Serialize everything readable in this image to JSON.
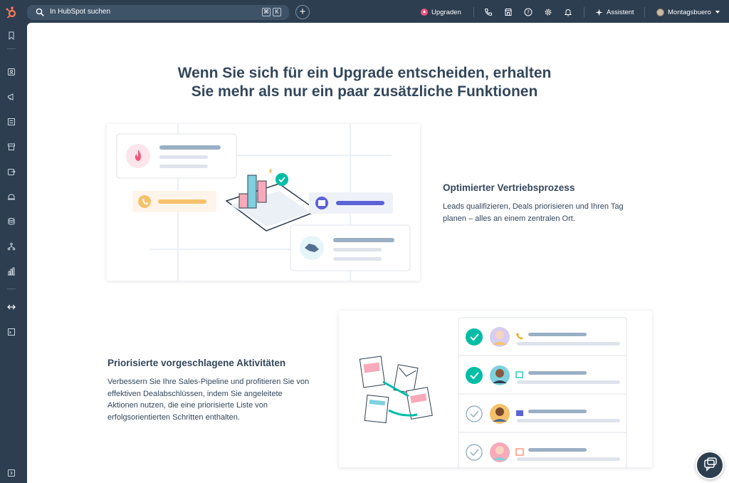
{
  "topbar": {
    "search_placeholder": "In HubSpot suchen",
    "shortcut_keys": [
      "⌘",
      "K"
    ],
    "upgrade_label": "Upgraden",
    "assistant_label": "Assistent",
    "account_name": "Montagsbuero"
  },
  "sidebar": {
    "icons": [
      "bookmark-icon",
      "contacts-icon",
      "marketing-icon",
      "content-icon",
      "commerce-icon",
      "sales-icon",
      "service-icon",
      "data-icon",
      "automation-icon",
      "reporting-icon",
      "collapse-icon",
      "apps-icon",
      "expand-icon"
    ]
  },
  "main": {
    "headline_line1": "Wenn Sie sich für ein Upgrade entscheiden, erhalten",
    "headline_line2": "Sie mehr als nur ein paar zusätzliche Funktionen",
    "feature1": {
      "title": "Optimierter Vertriebsprozess",
      "text_line1": "Leads qualifizieren, Deals priorisieren und Ihren Tag",
      "text_line2": "planen – alles an einem zentralen Ort."
    },
    "feature2": {
      "title": "Priorisierte vorgeschlagene Aktivitäten",
      "text_line1": "Verbessern Sie Ihre Sales-Pipeline und profitieren Sie von",
      "text_line2": "effektiven Dealabschlüssen, indem Sie angeleitete",
      "text_line3": "Aktionen nutzen, die eine priorisierte Liste von",
      "text_line4": "erfolgsorientierten Schritten enthalten."
    }
  },
  "colors": {
    "nav_bg": "#2d3e50",
    "text": "#33475b",
    "teal": "#00bda5",
    "accent_pink": "#f2547d"
  }
}
